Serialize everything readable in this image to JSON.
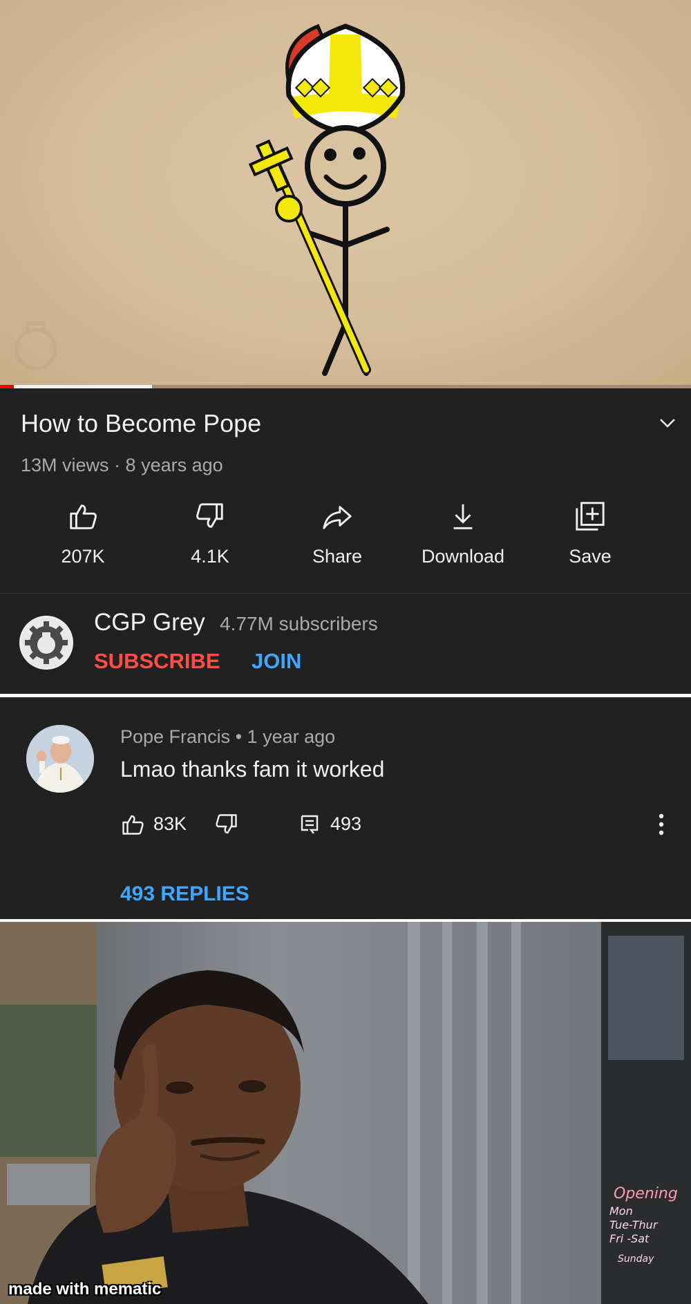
{
  "video": {
    "title": "How to Become Pope",
    "views": "13M views",
    "age": "8 years ago",
    "progress_played_fraction": 0.02,
    "progress_buffered_fraction": 0.22
  },
  "actions": [
    {
      "icon": "thumbs-up-icon",
      "label": "207K"
    },
    {
      "icon": "thumbs-down-icon",
      "label": "4.1K"
    },
    {
      "icon": "share-icon",
      "label": "Share"
    },
    {
      "icon": "download-icon",
      "label": "Download"
    },
    {
      "icon": "save-icon",
      "label": "Save"
    }
  ],
  "channel": {
    "name": "CGP Grey",
    "subscribers": "4.77M subscribers",
    "subscribe_label": "SUBSCRIBE",
    "join_label": "JOIN"
  },
  "comment": {
    "author": "Pope Francis",
    "time": "1 year ago",
    "text": "Lmao thanks fam it worked",
    "likes": "83K",
    "reply_count": "493",
    "replies_label": "493 REPLIES"
  },
  "meme": {
    "watermark": "made with mematic",
    "sign_text": [
      "Opening",
      "Mon",
      "Tue-Thur",
      "Fri -Sat",
      "Sunday"
    ]
  },
  "colors": {
    "background": "#212121",
    "text_primary": "#f1f1f1",
    "text_secondary": "#aaaaaa",
    "subscribe_red": "#ff4e45",
    "link_blue": "#3ea6ff",
    "progress_red": "#ff0000"
  }
}
